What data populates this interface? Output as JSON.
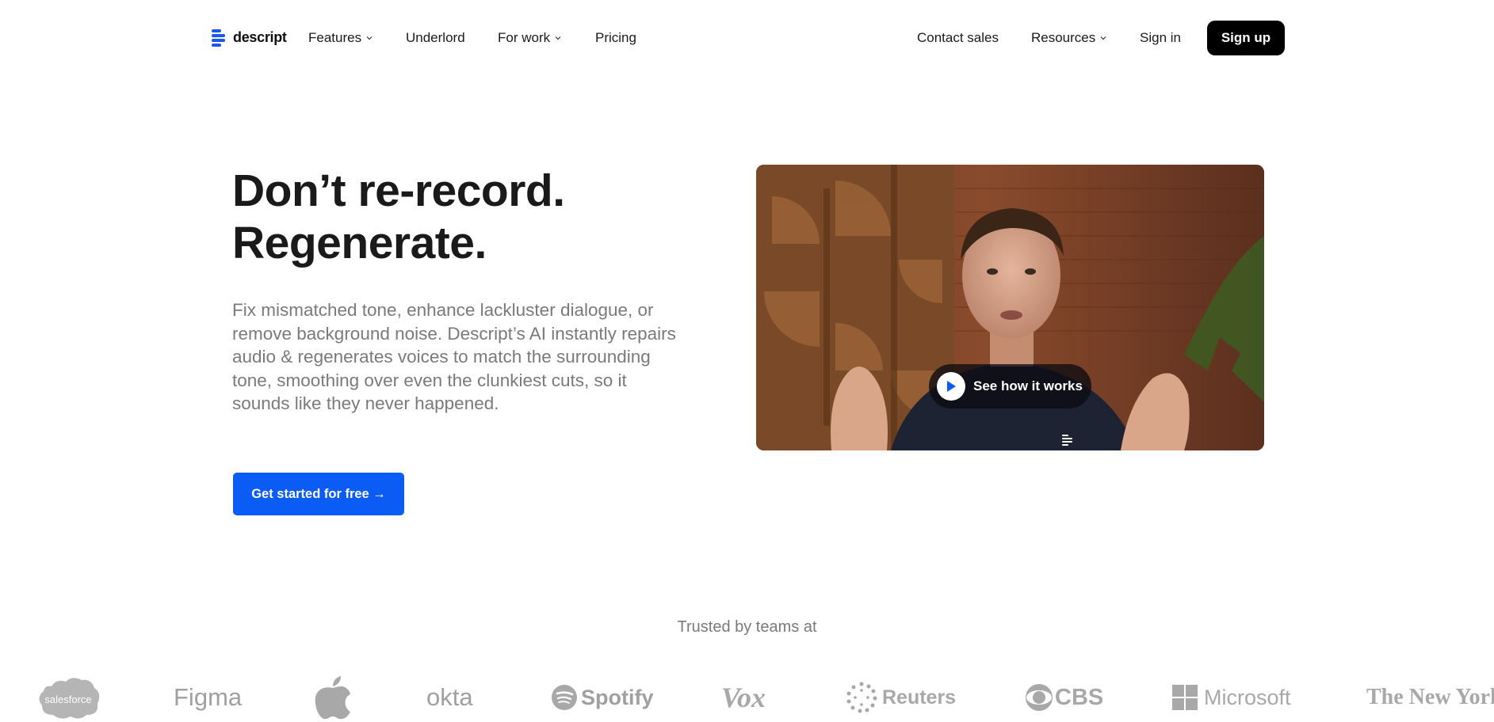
{
  "nav": {
    "logo_text": "descript",
    "items": [
      {
        "label": "Features",
        "has_dropdown": true
      },
      {
        "label": "Underlord",
        "has_dropdown": false
      },
      {
        "label": "For work",
        "has_dropdown": true
      },
      {
        "label": "Pricing",
        "has_dropdown": false
      }
    ],
    "right_items": [
      {
        "label": "Contact sales",
        "has_dropdown": false
      },
      {
        "label": "Resources",
        "has_dropdown": true
      },
      {
        "label": "Sign in",
        "has_dropdown": false
      }
    ],
    "signup_label": "Sign up"
  },
  "hero": {
    "headline_line1": "Don’t re-record.",
    "headline_line2": "Regenerate.",
    "description": "Fix mismatched tone, enhance lackluster dialogue, or remove background noise. Descript’s AI instantly repairs audio & regenerates voices to match the surrounding tone, smoothing over even the clunkiest cuts, so it sounds like they never happened.",
    "cta_label": "Get started for free →"
  },
  "video": {
    "play_label": "See how it works",
    "icon": "play-icon"
  },
  "trusted": {
    "label": "Trusted by teams at",
    "brands": [
      "salesforce",
      "Figma",
      "okta",
      "Spotify",
      "Vox",
      "Reuters",
      "CBS",
      "Microsoft",
      "The New York Times"
    ]
  },
  "colors": {
    "accent": "#0a5cf5",
    "signup_bg": "#000000",
    "muted_text": "#7a7a7a",
    "logo_gray": "#9a9a9a"
  }
}
